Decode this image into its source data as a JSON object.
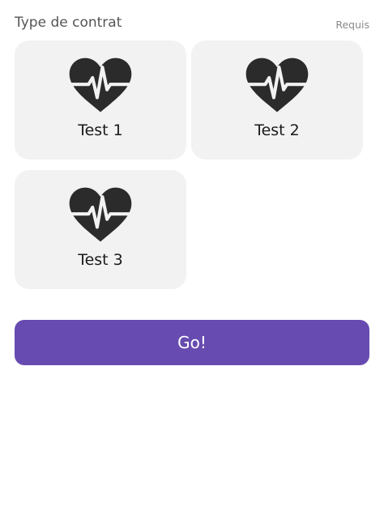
{
  "section": {
    "title": "Type de contrat",
    "required_label": "Requis"
  },
  "options": [
    {
      "label": "Test 1",
      "icon": "heartbeat-icon"
    },
    {
      "label": "Test 2",
      "icon": "heartbeat-icon"
    },
    {
      "label": "Test 3",
      "icon": "heartbeat-icon"
    }
  ],
  "actions": {
    "submit_label": "Go!"
  },
  "colors": {
    "accent": "#674bb0",
    "card_background": "#f2f2f2",
    "icon": "#2b2b2b",
    "title_text": "#555555",
    "required_text": "#8a8a8a"
  }
}
